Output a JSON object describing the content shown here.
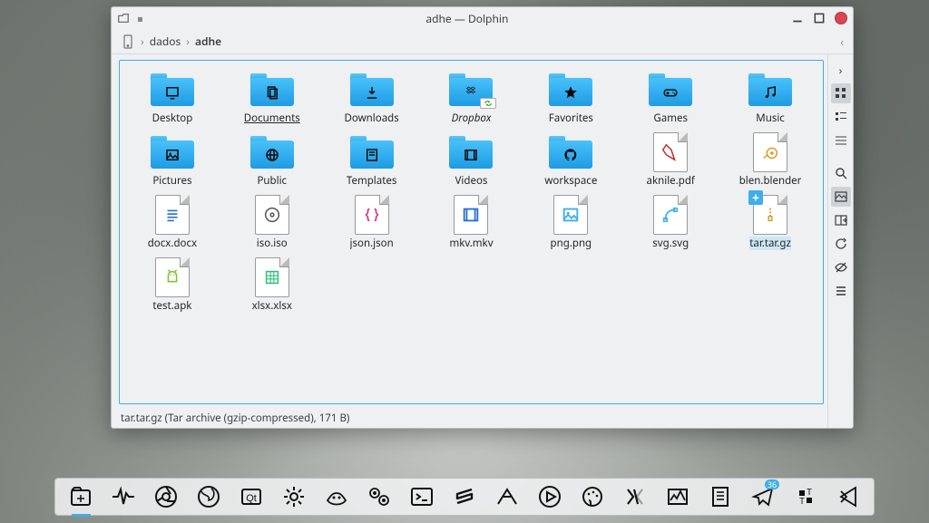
{
  "window": {
    "title": "adhe — Dolphin",
    "pin_glyph": "▪"
  },
  "breadcrumb": {
    "segments": [
      "dados",
      "adhe"
    ],
    "separator": "›"
  },
  "items": [
    {
      "kind": "folder",
      "label": "Desktop",
      "icon": "monitor"
    },
    {
      "kind": "folder",
      "label": "Documents",
      "icon": "documents",
      "underlined": true
    },
    {
      "kind": "folder",
      "label": "Downloads",
      "icon": "download"
    },
    {
      "kind": "folder",
      "label": "Dropbox",
      "icon": "dropbox",
      "italic": true,
      "badge": "sync"
    },
    {
      "kind": "folder",
      "label": "Favorites",
      "icon": "star"
    },
    {
      "kind": "folder",
      "label": "Games",
      "icon": "gamepad"
    },
    {
      "kind": "folder",
      "label": "Music",
      "icon": "music"
    },
    {
      "kind": "folder",
      "label": "Pictures",
      "icon": "image"
    },
    {
      "kind": "folder",
      "label": "Public",
      "icon": "globe"
    },
    {
      "kind": "folder",
      "label": "Templates",
      "icon": "template"
    },
    {
      "kind": "folder",
      "label": "Videos",
      "icon": "video"
    },
    {
      "kind": "folder",
      "label": "workspace",
      "icon": "github"
    },
    {
      "kind": "file",
      "label": "aknile.pdf",
      "icon": "pdf",
      "color": "#b92a2a"
    },
    {
      "kind": "file",
      "label": "blen.blender",
      "icon": "blender",
      "color": "#e09a29"
    },
    {
      "kind": "file",
      "label": "docx.docx",
      "icon": "text",
      "color": "#2a6fd1"
    },
    {
      "kind": "file",
      "label": "iso.iso",
      "icon": "disc",
      "color": "#555"
    },
    {
      "kind": "file",
      "label": "json.json",
      "icon": "json",
      "color": "#d1317f"
    },
    {
      "kind": "file",
      "label": "mkv.mkv",
      "icon": "video",
      "color": "#2a6fd1"
    },
    {
      "kind": "file",
      "label": "png.png",
      "icon": "image",
      "color": "#3daee9"
    },
    {
      "kind": "file",
      "label": "svg.svg",
      "icon": "svg",
      "color": "#3daee9"
    },
    {
      "kind": "file",
      "label": "tar.tar.gz",
      "icon": "archive",
      "color": "#caa02e",
      "selected": true,
      "emblem": "add"
    },
    {
      "kind": "file",
      "label": "test.apk",
      "icon": "android",
      "color": "#79c22e"
    },
    {
      "kind": "file",
      "label": "xlsx.xlsx",
      "icon": "sheet",
      "color": "#2abf7a"
    }
  ],
  "status": "tar.tar.gz (Tar archive (gzip-compressed), 171 B)",
  "toolstrip": {
    "back_glyph": "‹",
    "fwd_glyph": "›"
  },
  "taskbar": {
    "badge": "36",
    "appcount": 18
  }
}
